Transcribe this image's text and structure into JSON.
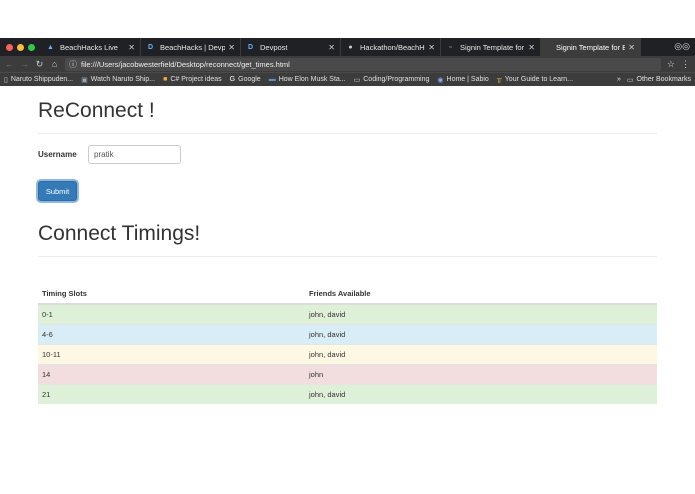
{
  "browser": {
    "tabs": [
      {
        "label": "BeachHacks Live",
        "icon": "beachhacks-icon",
        "active": false
      },
      {
        "label": "BeachHacks | Devpost",
        "icon": "devpost-icon",
        "active": false
      },
      {
        "label": "Devpost",
        "icon": "devpost-icon",
        "active": false
      },
      {
        "label": "Hackathon/BeachHack",
        "icon": "github-icon",
        "active": false
      },
      {
        "label": "Signin Template for Boo",
        "icon": "page-icon",
        "active": false
      },
      {
        "label": "Signin Template for Boo",
        "icon": "page-icon",
        "active": true
      }
    ],
    "url": "file:///Users/jacobwesterfield/Desktop/reconnect/get_times.html",
    "bookmarks": [
      {
        "label": "Naruto Shippuden...",
        "icon": "page-icon"
      },
      {
        "label": "Watch Naruto Ship...",
        "icon": "video-icon"
      },
      {
        "label": "C# Project ideas",
        "icon": "note-icon"
      },
      {
        "label": "Google",
        "icon": "google-icon"
      },
      {
        "label": "How Elon Musk Sta...",
        "icon": "site-icon"
      },
      {
        "label": "Coding/Programming",
        "icon": "folder-icon"
      },
      {
        "label": "Home | Sabio",
        "icon": "site-icon"
      },
      {
        "label": "Your Guide to Learn...",
        "icon": "site-icon"
      }
    ],
    "overflow": "»",
    "other_bookmarks": "Other Bookmarks"
  },
  "page": {
    "title": "ReConnect !",
    "username_label": "Username",
    "username_value": "pratik",
    "submit_label": "Submit",
    "timings_title": "Connect Timings!",
    "table": {
      "headers": [
        "Timing Slots",
        "Friends Available"
      ],
      "rows": [
        {
          "slot": "0-1",
          "friends": "john, david",
          "status": "success"
        },
        {
          "slot": "4-6",
          "friends": "john, david",
          "status": "info"
        },
        {
          "slot": "10-11",
          "friends": "john, david",
          "status": "warning"
        },
        {
          "slot": "14",
          "friends": "john",
          "status": "danger"
        },
        {
          "slot": "21",
          "friends": "john, david",
          "status": "success"
        }
      ]
    }
  }
}
